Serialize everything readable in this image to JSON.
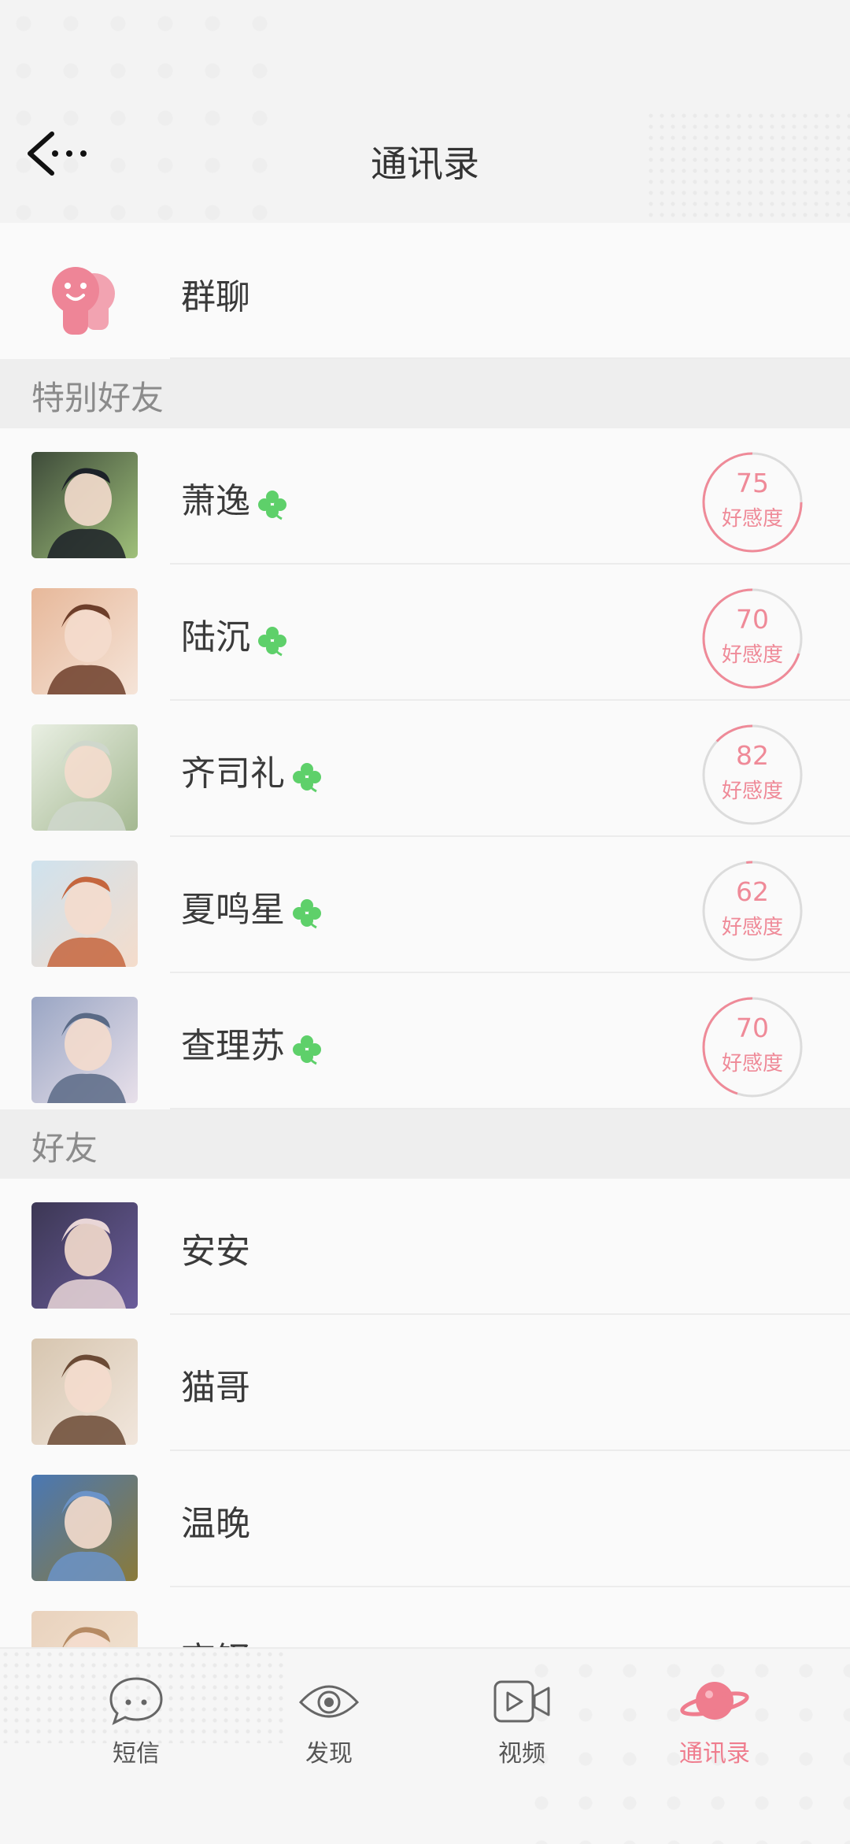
{
  "header": {
    "title": "通讯录",
    "back_icon": "back-arrow-icon"
  },
  "group": {
    "label": "群聊",
    "icon": "group-chat-icon"
  },
  "sections": {
    "special": "特别好友",
    "friends": "好友"
  },
  "special_friends": [
    {
      "name": "萧逸",
      "affinity": "75",
      "affinity_label": "好感度",
      "progress": 0.75
    },
    {
      "name": "陆沉",
      "affinity": "70",
      "affinity_label": "好感度",
      "progress": 0.7
    },
    {
      "name": "齐司礼",
      "affinity": "82",
      "affinity_label": "好感度",
      "progress": 0.13
    },
    {
      "name": "夏鸣星",
      "affinity": "62",
      "affinity_label": "好感度",
      "progress": 0.02
    },
    {
      "name": "查理苏",
      "affinity": "70",
      "affinity_label": "好感度",
      "progress": 0.45
    }
  ],
  "friends": [
    {
      "name": "安安"
    },
    {
      "name": "猫哥"
    },
    {
      "name": "温晚"
    },
    {
      "name": "高铎"
    }
  ],
  "nav": {
    "items": [
      {
        "label": "短信",
        "icon": "message-bubble-icon"
      },
      {
        "label": "发现",
        "icon": "eye-icon"
      },
      {
        "label": "视频",
        "icon": "video-camera-icon"
      },
      {
        "label": "通讯录",
        "icon": "planet-icon"
      }
    ],
    "active_index": 3
  },
  "colors": {
    "accent": "#ef7d8e",
    "clover": "#5ed06a"
  }
}
